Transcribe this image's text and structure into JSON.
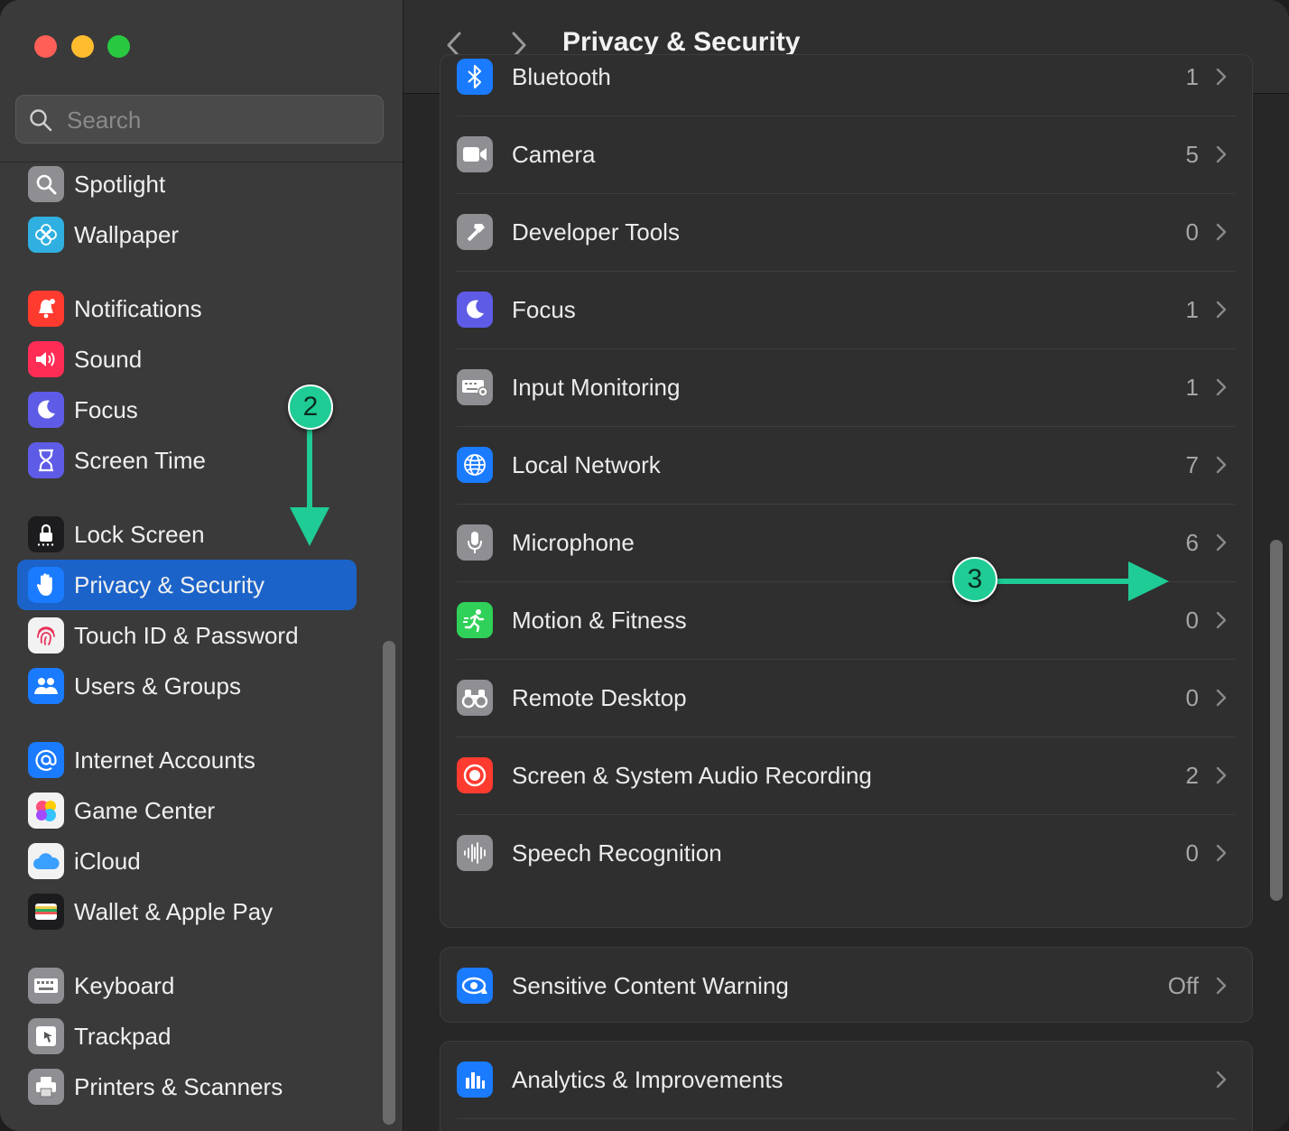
{
  "window": {
    "title": "Privacy & Security"
  },
  "search": {
    "placeholder": "Search"
  },
  "sidebar": {
    "items": [
      {
        "label": "Spotlight",
        "icon": "spotlight-icon",
        "color": "#8e8e93"
      },
      {
        "label": "Wallpaper",
        "icon": "wallpaper-icon",
        "color": "#30b0e0"
      },
      {
        "label": "Notifications",
        "icon": "notifications-icon",
        "color": "#ff3b30"
      },
      {
        "label": "Sound",
        "icon": "sound-icon",
        "color": "#ff2d55"
      },
      {
        "label": "Focus",
        "icon": "focus-icon",
        "color": "#5e5ce6"
      },
      {
        "label": "Screen Time",
        "icon": "screen-time-icon",
        "color": "#5e5ce6"
      },
      {
        "label": "Lock Screen",
        "icon": "lock-screen-icon",
        "color": "#1c1c1e"
      },
      {
        "label": "Privacy & Security",
        "icon": "privacy-hand-icon",
        "color": "#1a7bff",
        "selected": true
      },
      {
        "label": "Touch ID & Password",
        "icon": "fingerprint-icon",
        "color": "#f2f2f2"
      },
      {
        "label": "Users & Groups",
        "icon": "users-icon",
        "color": "#1a7bff"
      },
      {
        "label": "Internet Accounts",
        "icon": "at-icon",
        "color": "#1a7bff"
      },
      {
        "label": "Game Center",
        "icon": "game-center-icon",
        "color": "#f2f2f2"
      },
      {
        "label": "iCloud",
        "icon": "icloud-icon",
        "color": "#f2f2f2"
      },
      {
        "label": "Wallet & Apple Pay",
        "icon": "wallet-icon",
        "color": "#1c1c1e"
      },
      {
        "label": "Keyboard",
        "icon": "keyboard-icon",
        "color": "#8e8e93"
      },
      {
        "label": "Trackpad",
        "icon": "trackpad-icon",
        "color": "#8e8e93"
      },
      {
        "label": "Printers & Scanners",
        "icon": "printer-icon",
        "color": "#8e8e93"
      }
    ]
  },
  "privacy_rows": [
    {
      "label": "Bluetooth",
      "value": "1",
      "icon": "bluetooth-icon",
      "color": "#1a7bff"
    },
    {
      "label": "Camera",
      "value": "5",
      "icon": "camera-icon",
      "color": "#8e8e93"
    },
    {
      "label": "Developer Tools",
      "value": "0",
      "icon": "hammer-icon",
      "color": "#8e8e93"
    },
    {
      "label": "Focus",
      "value": "1",
      "icon": "focus-moon-icon",
      "color": "#5e5ce6"
    },
    {
      "label": "Input Monitoring",
      "value": "1",
      "icon": "keyboard-monitor-icon",
      "color": "#8e8e93"
    },
    {
      "label": "Local Network",
      "value": "7",
      "icon": "globe-icon",
      "color": "#1a7bff"
    },
    {
      "label": "Microphone",
      "value": "6",
      "icon": "microphone-icon",
      "color": "#8e8e93"
    },
    {
      "label": "Motion & Fitness",
      "value": "0",
      "icon": "running-icon",
      "color": "#30d158"
    },
    {
      "label": "Remote Desktop",
      "value": "0",
      "icon": "binoculars-icon",
      "color": "#8e8e93"
    },
    {
      "label": "Screen & System Audio Recording",
      "value": "2",
      "icon": "record-icon",
      "color": "#ff3b30"
    },
    {
      "label": "Speech Recognition",
      "value": "0",
      "icon": "waveform-icon",
      "color": "#8e8e93"
    }
  ],
  "sensitive": {
    "label": "Sensitive Content Warning",
    "value": "Off",
    "icon": "eye-warning-icon",
    "color": "#1a7bff"
  },
  "analytics": {
    "label": "Analytics & Improvements",
    "icon": "analytics-icon",
    "color": "#1a7bff"
  },
  "annotations": {
    "step2": "2",
    "step3": "3",
    "accent": "#1fcc95"
  }
}
